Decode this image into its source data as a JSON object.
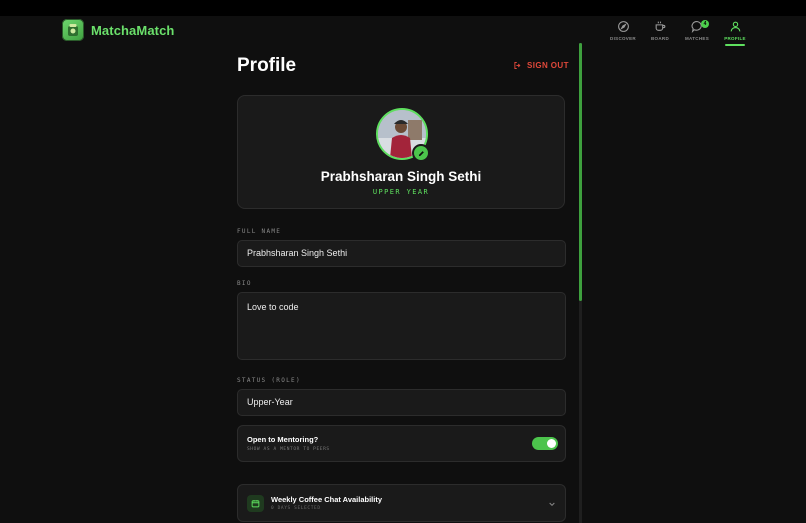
{
  "app": {
    "brand": "MatchaMatch"
  },
  "nav": {
    "items": [
      {
        "label": "DISCOVER",
        "icon": "compass-icon"
      },
      {
        "label": "BOARD",
        "icon": "coffee-cup-icon"
      },
      {
        "label": "MATCHES",
        "icon": "chat-bubble-icon",
        "badge": "4"
      },
      {
        "label": "PROFILE",
        "icon": "user-icon",
        "active": true
      }
    ]
  },
  "page": {
    "title": "Profile",
    "signout_label": "SIGN OUT"
  },
  "profile": {
    "name": "Prabhsharan Singh Sethi",
    "role": "UPPER YEAR"
  },
  "fields": {
    "full_name": {
      "label": "FULL NAME",
      "value": "Prabhsharan Singh Sethi"
    },
    "bio": {
      "label": "BIO",
      "value": "Love to code"
    },
    "status": {
      "label": "STATUS (ROLE)",
      "value": "Upper-Year"
    }
  },
  "mentoring": {
    "title": "Open to Mentoring?",
    "subtitle": "SHOW AS A MENTOR TO PEERS",
    "enabled": true
  },
  "availability": {
    "title": "Weekly Coffee Chat Availability",
    "subtitle": "0 DAYS SELECTED"
  },
  "colors": {
    "accent": "#5fe05f",
    "danger": "#e0483a",
    "background": "#0f0f0f",
    "card": "#1a1a1a"
  }
}
